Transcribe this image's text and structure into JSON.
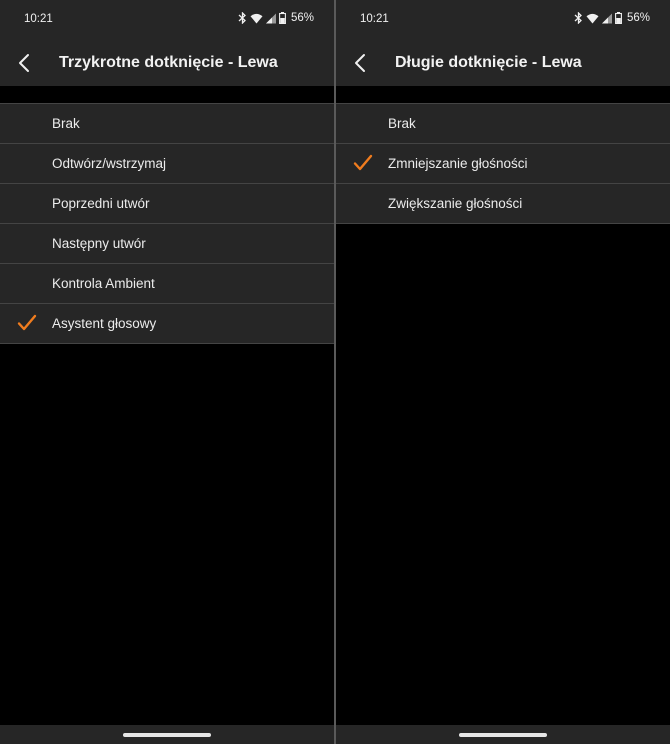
{
  "accent_color": "#f07c1e",
  "screens": [
    {
      "status": {
        "time": "10:21",
        "battery": "56%"
      },
      "title": "Trzykrotne dotknięcie - Lewa",
      "options": [
        {
          "label": "Brak",
          "selected": false
        },
        {
          "label": "Odtwórz/wstrzymaj",
          "selected": false
        },
        {
          "label": "Poprzedni utwór",
          "selected": false
        },
        {
          "label": "Następny utwór",
          "selected": false
        },
        {
          "label": "Kontrola Ambient",
          "selected": false
        },
        {
          "label": "Asystent głosowy",
          "selected": true
        }
      ]
    },
    {
      "status": {
        "time": "10:21",
        "battery": "56%"
      },
      "title": "Długie dotknięcie - Lewa",
      "options": [
        {
          "label": "Brak",
          "selected": false
        },
        {
          "label": "Zmniejszanie głośności",
          "selected": true
        },
        {
          "label": "Zwiększanie głośności",
          "selected": false
        }
      ]
    }
  ]
}
